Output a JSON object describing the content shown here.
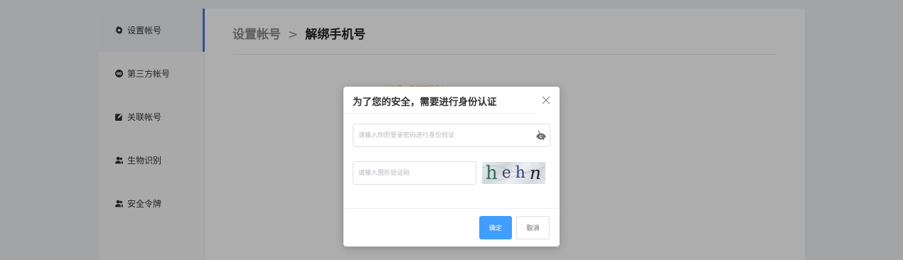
{
  "sidebar": {
    "items": [
      {
        "label": "设置帐号",
        "icon": "gear-icon",
        "active": true
      },
      {
        "label": "第三方帐号",
        "icon": "link-icon",
        "active": false
      },
      {
        "label": "关联帐号",
        "icon": "edit-icon",
        "active": false
      },
      {
        "label": "生物识别",
        "icon": "users-icon",
        "active": false
      },
      {
        "label": "安全令牌",
        "icon": "users-icon",
        "active": false
      }
    ]
  },
  "breadcrumb": {
    "parent": "设置帐号",
    "separator": ">",
    "current": "解绑手机号"
  },
  "warning": {
    "text": "关帐号，请谨慎操作！"
  },
  "dialog": {
    "title": "为了您的安全，需要进行身份认证",
    "password_placeholder": "请输入你的登录密码进行身份验证",
    "code_placeholder": "请输入图形验证码",
    "captcha_text": "hehn",
    "confirm_label": "确定",
    "cancel_label": "取消"
  },
  "colors": {
    "primary": "#409eff",
    "active_indicator": "#4a7bd1",
    "warning": "#e6a23c"
  }
}
